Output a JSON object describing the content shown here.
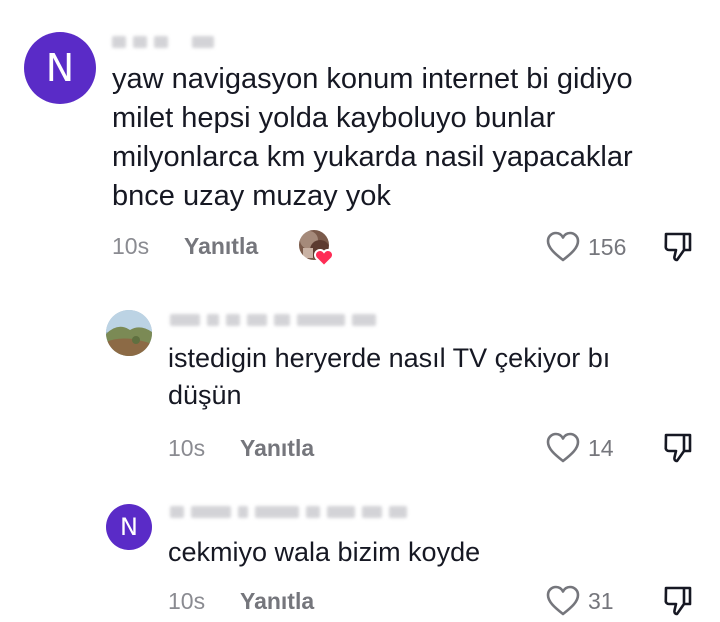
{
  "comments": [
    {
      "avatar_letter": "N",
      "avatar_color": "#5a2bc7",
      "text": "yaw navigasyon konum internet bi gidiyo\nmilet hepsi yolda kayboluyo bunlar\nmilyonlarca km yukarda nasil yapacaklar\nbnce uzay muzay yok",
      "time": "10s",
      "reply_label": "Yanıtla",
      "likes": "156",
      "creator_liked": true
    },
    {
      "avatar_letter": "",
      "text": "istedigin heryerde nasıl TV çekiyor bı\ndüşün",
      "time": "10s",
      "reply_label": "Yanıtla",
      "likes": "14"
    },
    {
      "avatar_letter": "N",
      "avatar_color": "#5a2bc7",
      "text": "cekmiyo wala bizim koyde",
      "time": "10s",
      "reply_label": "Yanıtla",
      "likes": "31"
    }
  ],
  "colors": {
    "text": "#161823",
    "muted": "#8a8b91",
    "heart_outline": "#75767c",
    "creator_heart": "#fe2c55"
  },
  "icons": {
    "like": "heart-outline-icon",
    "dislike": "thumbs-down-icon",
    "creator_liked": "heart-filled-icon"
  }
}
